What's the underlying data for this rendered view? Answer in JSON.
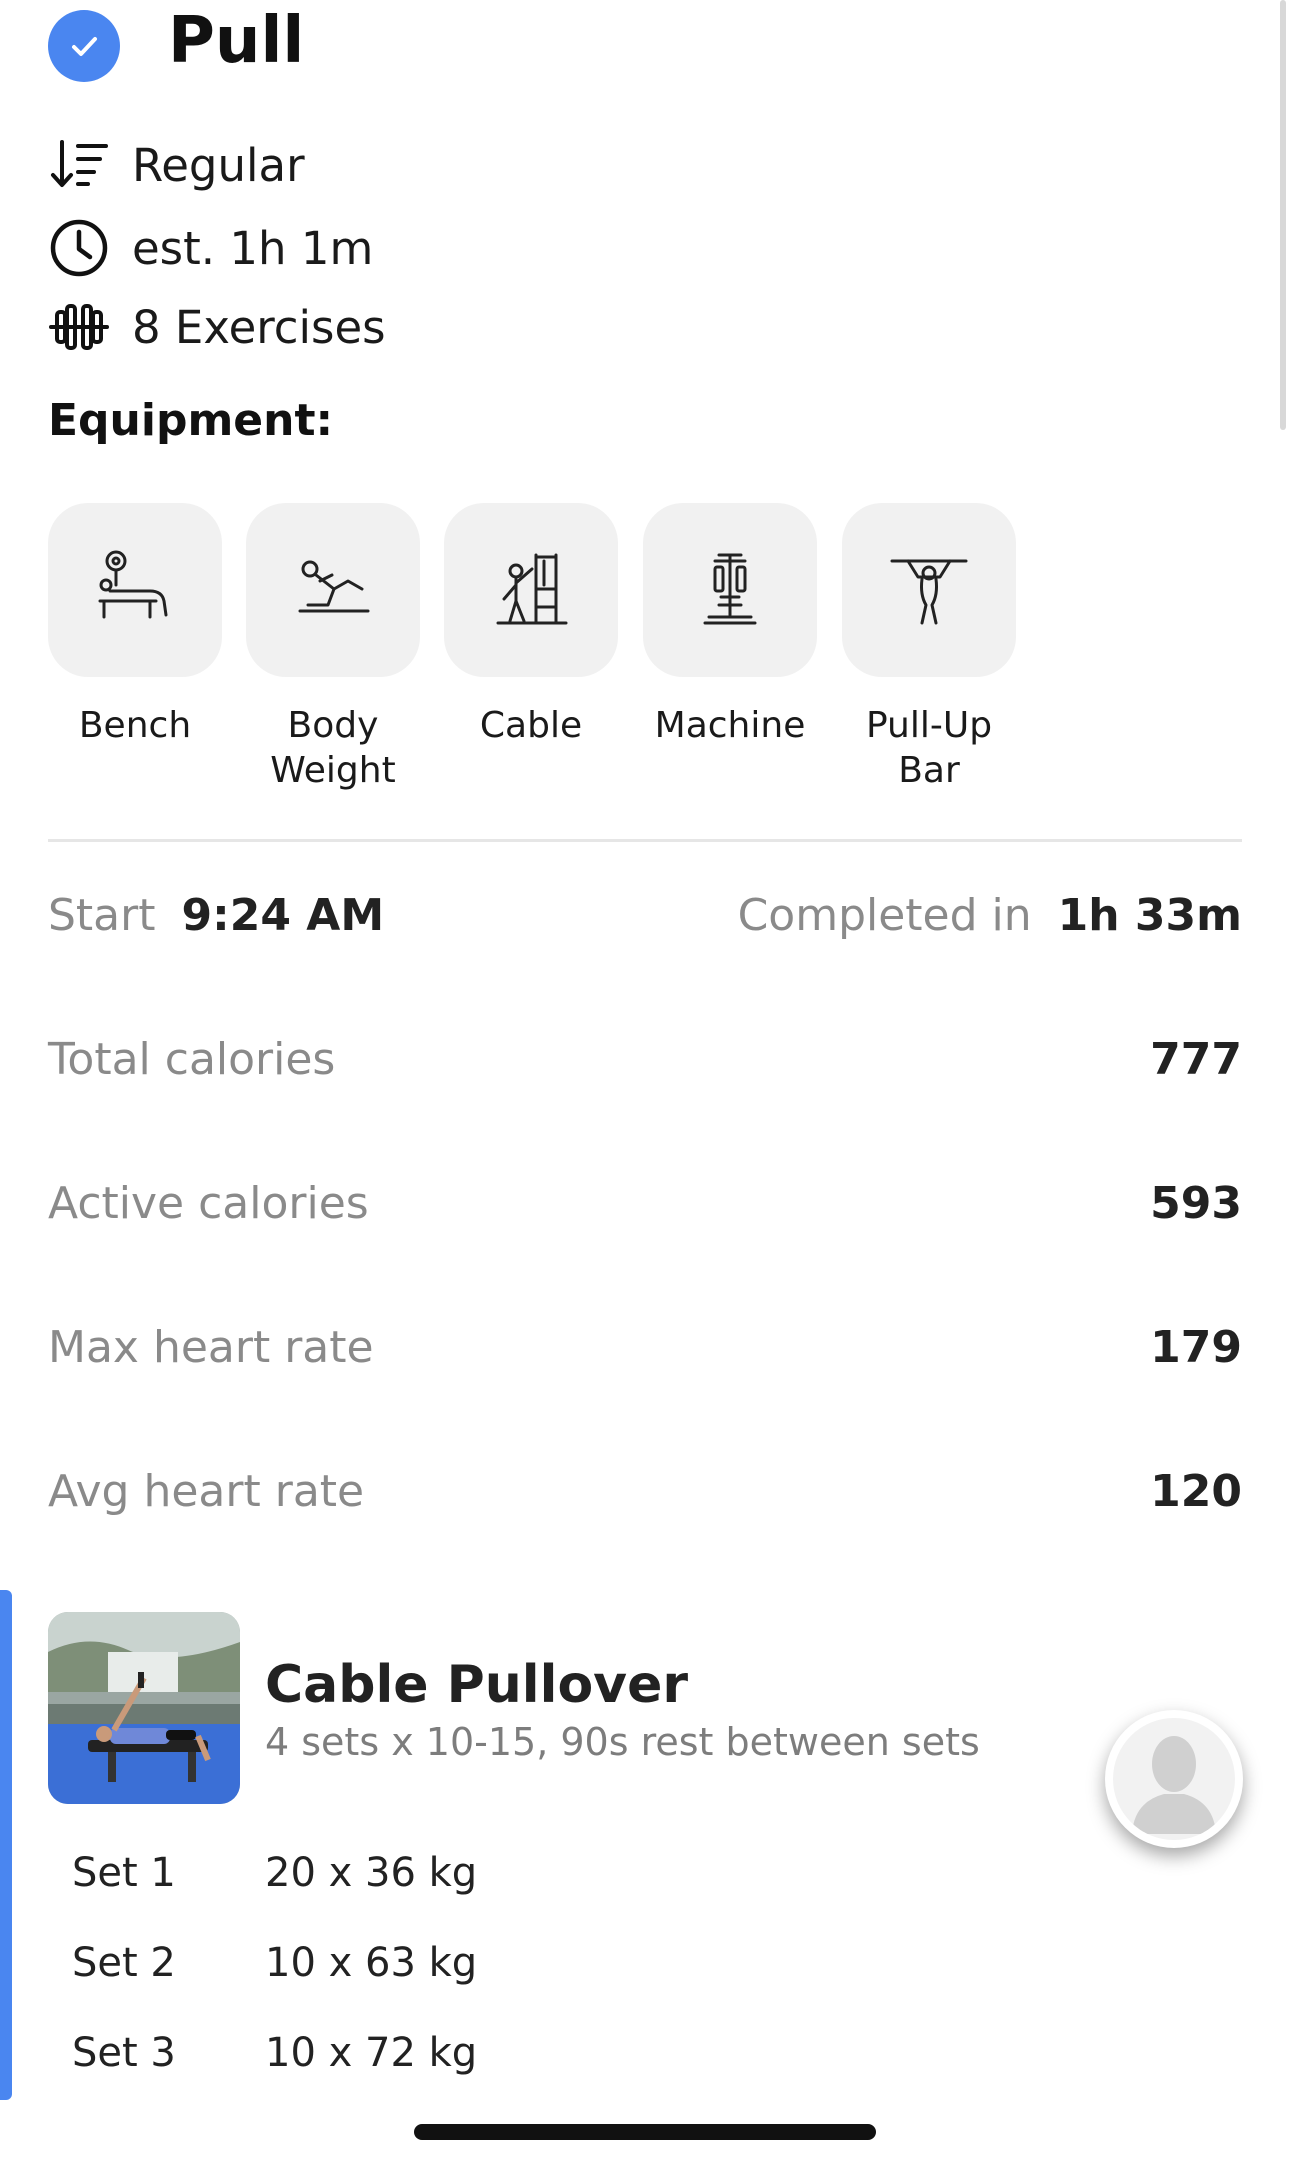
{
  "workout": {
    "title": "Pull",
    "type": "Regular",
    "duration": "est. 1h 1m",
    "exercise_count": "8 Exercises"
  },
  "equipment": {
    "heading": "Equipment:",
    "items": [
      {
        "label": "Bench",
        "icon": "bench-icon"
      },
      {
        "label": "Body Weight",
        "icon": "body-weight-icon"
      },
      {
        "label": "Cable",
        "icon": "cable-icon"
      },
      {
        "label": "Machine",
        "icon": "machine-icon"
      },
      {
        "label": "Pull-Up Bar",
        "icon": "pull-up-bar-icon"
      }
    ]
  },
  "summary": {
    "start_label": "Start",
    "start_value": "9:24 AM",
    "completed_label": "Completed in",
    "completed_value": "1h 33m",
    "stats": [
      {
        "label": "Total calories",
        "value": "777"
      },
      {
        "label": "Active calories",
        "value": "593"
      },
      {
        "label": "Max heart rate",
        "value": "179"
      },
      {
        "label": "Avg heart rate",
        "value": "120"
      }
    ]
  },
  "exercise": {
    "name": "Cable Pullover",
    "details": "4 sets x 10-15, 90s rest between sets",
    "sets": [
      {
        "label": "Set 1",
        "value": "20 x 36 kg"
      },
      {
        "label": "Set 2",
        "value": "10 x 63 kg"
      },
      {
        "label": "Set 3",
        "value": "10 x 72 kg"
      }
    ]
  },
  "colors": {
    "accent": "#4a86f0",
    "tile_bg": "#f1f1f1",
    "muted_text": "#8a8a8a"
  }
}
